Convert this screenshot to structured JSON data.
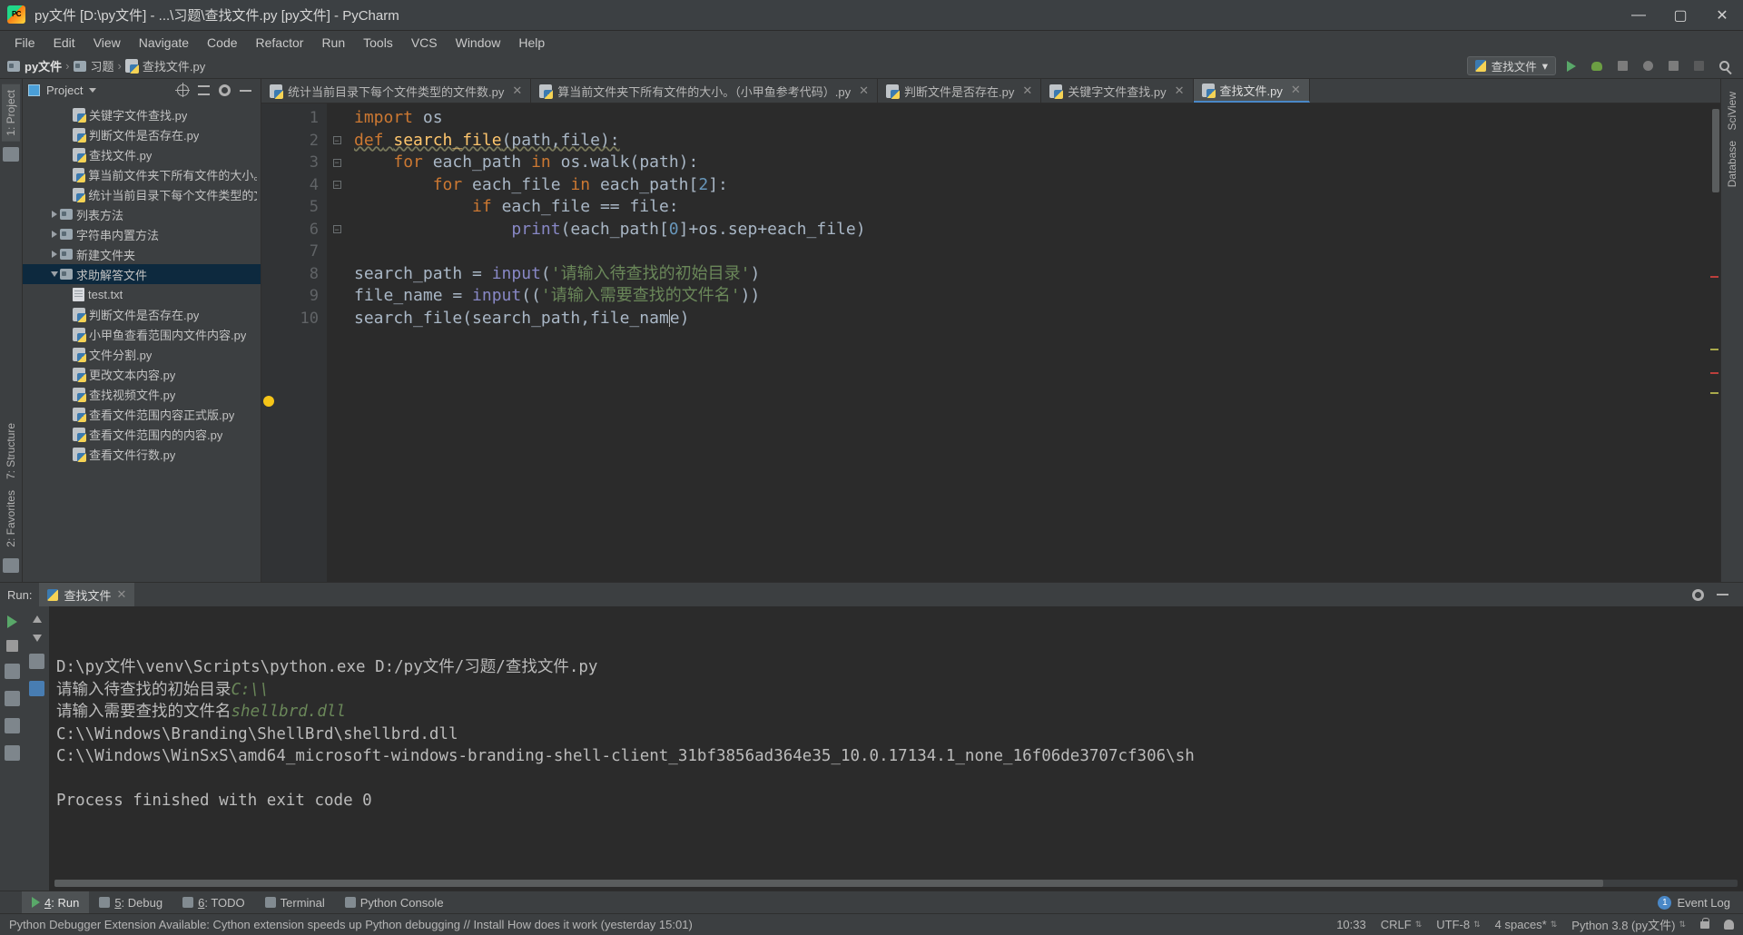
{
  "window": {
    "title": "py文件 [D:\\py文件] - ...\\习题\\查找文件.py [py文件] - PyCharm",
    "app_icon": "pycharm-icon",
    "minimize": "—",
    "maximize": "▢",
    "close": "✕"
  },
  "menu": {
    "items": [
      "File",
      "Edit",
      "View",
      "Navigate",
      "Code",
      "Refactor",
      "Run",
      "Tools",
      "VCS",
      "Window",
      "Help"
    ]
  },
  "breadcrumb": {
    "items": [
      "py文件",
      "习题",
      "查找文件.py"
    ],
    "separator": "›"
  },
  "toolbar": {
    "run_config": "查找文件",
    "run_config_caret": "▾",
    "buttons": [
      "run-icon",
      "debug-icon",
      "coverage-icon",
      "profile-icon",
      "attach-icon",
      "stop-icon",
      "search-icon"
    ]
  },
  "left_strip": {
    "project_tab": "1: Project",
    "structure_tab": "7: Structure",
    "favorites_tab": "2: Favorites"
  },
  "right_strip": {
    "sciview_tab": "SciView",
    "database_tab": "Database"
  },
  "project": {
    "title": "Project",
    "caret": "▾",
    "tree": [
      {
        "label": "关键字文件查找.py",
        "icon": "python-file-icon",
        "indent": 3,
        "arrow": "none",
        "selected": false
      },
      {
        "label": "判断文件是否存在.py",
        "icon": "python-file-icon",
        "indent": 3,
        "arrow": "none",
        "selected": false
      },
      {
        "label": "查找文件.py",
        "icon": "python-file-icon",
        "indent": 3,
        "arrow": "none",
        "selected": false
      },
      {
        "label": "算当前文件夹下所有文件的大小。",
        "icon": "python-file-icon",
        "indent": 3,
        "arrow": "none",
        "selected": false
      },
      {
        "label": "统计当前目录下每个文件类型的文",
        "icon": "python-file-icon",
        "indent": 3,
        "arrow": "none",
        "selected": false
      },
      {
        "label": "列表方法",
        "icon": "folder-icon",
        "indent": 2,
        "arrow": "closed",
        "selected": false
      },
      {
        "label": "字符串内置方法",
        "icon": "folder-icon",
        "indent": 2,
        "arrow": "closed",
        "selected": false
      },
      {
        "label": "新建文件夹",
        "icon": "folder-icon",
        "indent": 2,
        "arrow": "closed",
        "selected": false
      },
      {
        "label": "求助解答文件",
        "icon": "folder-icon",
        "indent": 2,
        "arrow": "open",
        "selected": true
      },
      {
        "label": "test.txt",
        "icon": "text-file-icon",
        "indent": 3,
        "arrow": "none",
        "selected": false
      },
      {
        "label": "判断文件是否存在.py",
        "icon": "python-file-icon",
        "indent": 3,
        "arrow": "none",
        "selected": false
      },
      {
        "label": "小甲鱼查看范围内文件内容.py",
        "icon": "python-file-icon",
        "indent": 3,
        "arrow": "none",
        "selected": false
      },
      {
        "label": "文件分割.py",
        "icon": "python-file-icon",
        "indent": 3,
        "arrow": "none",
        "selected": false
      },
      {
        "label": "更改文本内容.py",
        "icon": "python-file-icon",
        "indent": 3,
        "arrow": "none",
        "selected": false
      },
      {
        "label": "查找视频文件.py",
        "icon": "python-file-icon",
        "indent": 3,
        "arrow": "none",
        "selected": false
      },
      {
        "label": "查看文件范围内容正式版.py",
        "icon": "python-file-icon",
        "indent": 3,
        "arrow": "none",
        "selected": false
      },
      {
        "label": "查看文件范围内的内容.py",
        "icon": "python-file-icon",
        "indent": 3,
        "arrow": "none",
        "selected": false
      },
      {
        "label": "查看文件行数.py",
        "icon": "python-file-icon",
        "indent": 3,
        "arrow": "none",
        "selected": false
      }
    ]
  },
  "editor_tabs": [
    {
      "label": "统计当前目录下每个文件类型的文件数.py",
      "active": false,
      "close": "✕"
    },
    {
      "label": "算当前文件夹下所有文件的大小。（小甲鱼参考代码）.py",
      "active": false,
      "close": "✕"
    },
    {
      "label": "判断文件是否存在.py",
      "active": false,
      "close": "✕"
    },
    {
      "label": "关键字文件查找.py",
      "active": false,
      "close": "✕"
    },
    {
      "label": "查找文件.py",
      "active": true,
      "close": "✕"
    }
  ],
  "code": {
    "line_numbers": [
      "1",
      "2",
      "3",
      "4",
      "5",
      "6",
      "7",
      "8",
      "9",
      "10"
    ],
    "lines": [
      "import os",
      "def search_file(path,file):",
      "    for each_path in os.walk(path):",
      "        for each_file in each_path[2]:",
      "            if each_file == file:",
      "                print(each_path[0]+os.sep+each_file)",
      "",
      "search_path = input('请输入待查找的初始目录')",
      "file_name = input(('请输入需要查找的文件名'))",
      "search_file(search_path,file_name)"
    ]
  },
  "run_panel": {
    "label": "Run:",
    "tab": "查找文件",
    "tab_close": "✕",
    "console_lines": [
      {
        "text": "D:\\py文件\\venv\\Scripts\\python.exe D:/py文件/习题/查找文件.py",
        "style": "plain"
      },
      {
        "text": "请输入待查找的初始目录",
        "input": "C:\\\\",
        "style": "prompt"
      },
      {
        "text": "请输入需要查找的文件名",
        "input": "shellbrd.dll",
        "style": "prompt"
      },
      {
        "text": "C:\\\\Windows\\Branding\\ShellBrd\\shellbrd.dll",
        "style": "plain"
      },
      {
        "text": "C:\\\\Windows\\WinSxS\\amd64_microsoft-windows-branding-shell-client_31bf3856ad364e35_10.0.17134.1_none_16f06de3707cf306\\sh",
        "style": "plain"
      },
      {
        "text": "",
        "style": "plain"
      },
      {
        "text": "Process finished with exit code 0",
        "style": "plain"
      }
    ]
  },
  "bottom_tabs": [
    {
      "label": "4: Run",
      "icon": "run-icon",
      "active": true
    },
    {
      "label": "5: Debug",
      "icon": "debug-icon",
      "active": false
    },
    {
      "label": "6: TODO",
      "icon": "todo-icon",
      "active": false
    },
    {
      "label": "Terminal",
      "icon": "terminal-icon",
      "active": false
    },
    {
      "label": "Python Console",
      "icon": "python-console-icon",
      "active": false
    }
  ],
  "event_log": {
    "label": "Event Log",
    "badge": "1"
  },
  "status_bar": {
    "message": "Python Debugger Extension Available: Cython extension speeds up Python debugging // Install How does it work (yesterday 15:01)",
    "caret_position": "10:33",
    "line_separator": "CRLF",
    "encoding": "UTF-8",
    "indent": "4 spaces*",
    "interpreter": "Python 3.8 (py文件)",
    "lock_icon": "lock-icon"
  },
  "colors": {
    "accent": "#4a88c7",
    "selection": "#0d293e",
    "editor_bg": "#2b2b2b",
    "panel_bg": "#3c3f41",
    "keyword": "#cc7832",
    "function": "#ffc66d",
    "number": "#6897bb",
    "string": "#6a8759",
    "builtin": "#8888c6",
    "run_green": "#59a869"
  }
}
